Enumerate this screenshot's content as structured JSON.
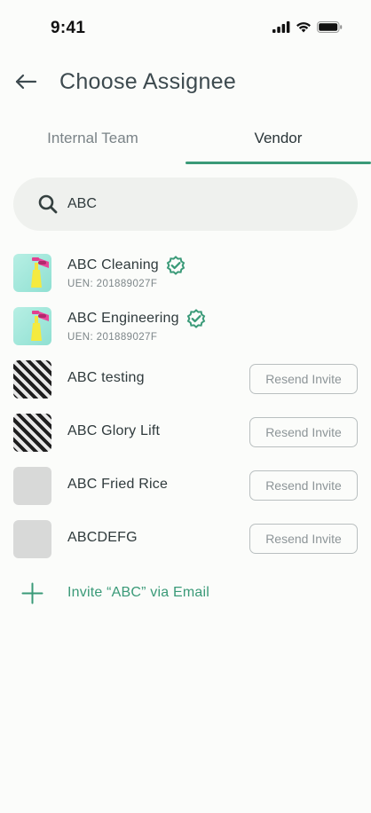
{
  "status_bar": {
    "time": "9:41"
  },
  "header": {
    "title": "Choose Assignee"
  },
  "tabs": [
    {
      "label": "Internal Team",
      "active": false
    },
    {
      "label": "Vendor",
      "active": true
    }
  ],
  "search": {
    "value": "ABC",
    "placeholder": ""
  },
  "vendors": [
    {
      "name": "ABC Cleaning",
      "verified": true,
      "uen": "UEN: 201889027F",
      "avatar": "cleaning-spray-icon"
    },
    {
      "name": "ABC Engineering",
      "verified": true,
      "uen": "UEN: 201889027F",
      "avatar": "cleaning-spray-icon"
    },
    {
      "name": "ABC testing",
      "verified": false,
      "action_label": "Resend Invite",
      "avatar": "striped-logo"
    },
    {
      "name": "ABC Glory Lift",
      "verified": false,
      "action_label": "Resend Invite",
      "avatar": "striped-logo"
    },
    {
      "name": "ABC Fried Rice",
      "verified": false,
      "action_label": "Resend Invite",
      "avatar": "blank"
    },
    {
      "name": "ABCDEFG",
      "verified": false,
      "action_label": "Resend Invite",
      "avatar": "blank"
    }
  ],
  "invite": {
    "label": "Invite “ABC” via Email"
  },
  "colors": {
    "accent": "#3a9a78",
    "background": "#fbfcfa",
    "search_bg": "#eff1ee"
  }
}
